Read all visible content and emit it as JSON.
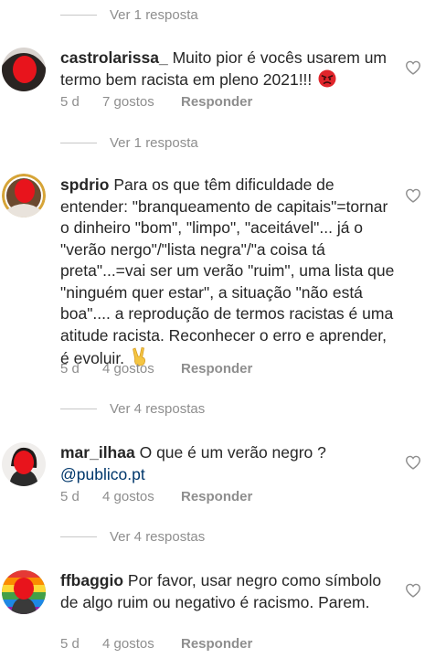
{
  "thread": {
    "top_view_replies": "Ver 1 resposta",
    "comments": [
      {
        "username": "castrolarissa_",
        "text": "Muito pior é vocês usarem um termo bem racista em pleno 2021!!!",
        "emoji": "angry-face-emoji",
        "time": "5 d",
        "likes": "7 gostos",
        "reply_label": "Responder",
        "view_replies": "Ver 1 resposta"
      },
      {
        "username": "spdrio",
        "text": "Para os que têm dificuldade de entender: \"branqueamento de capitais\"=tornar o dinheiro \"bom\", \"limpo\", \"aceitável\"... já o \"verão nergo\"/\"lista negra\"/\"a coisa tá preta\"...=vai ser um verão \"ruim\", uma lista que \"ninguém quer estar\", a situação \"não está boa\".... a reprodução de termos racistas é uma atitude racista. Reconhecer o erro e aprender, é evoluir.",
        "emoji": "victory-hand-emoji",
        "time": "5 d",
        "likes": "4 gostos",
        "reply_label": "Responder",
        "view_replies": "Ver 4 respostas"
      },
      {
        "username": "mar_ilhaa",
        "text": "O que é um verão negro ?",
        "mention": "@publico.pt",
        "time": "5 d",
        "likes": "4 gostos",
        "reply_label": "Responder",
        "view_replies": "Ver 4 respostas"
      },
      {
        "username": "ffbaggio",
        "text": "Por favor, usar negro como símbolo de algo ruim ou negativo é racismo. Parem.",
        "time": "5 d",
        "likes": "4 gostos",
        "reply_label": "Responder"
      }
    ]
  },
  "icons": {
    "like": "heart-outline-icon"
  },
  "colors": {
    "text": "#262626",
    "secondary": "#8e8e8e",
    "mention": "#00376b",
    "redaction": "#e8141c"
  }
}
